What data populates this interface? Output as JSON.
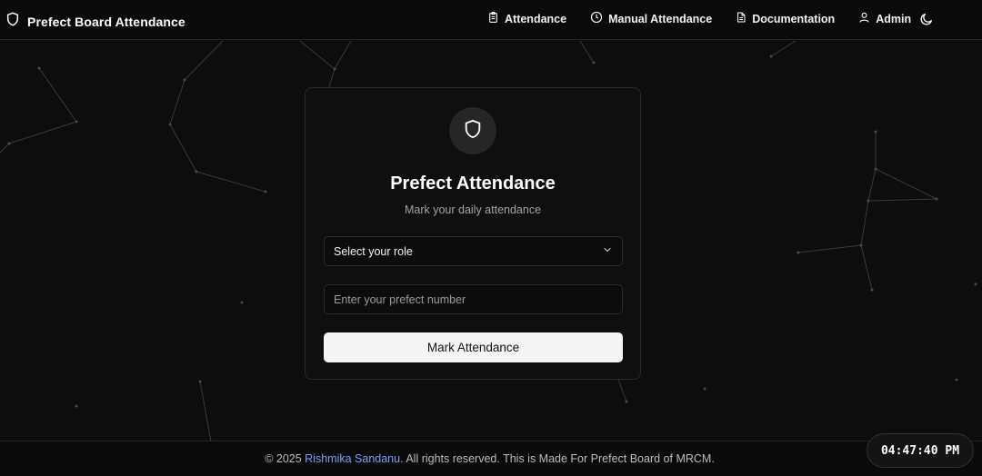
{
  "brand": {
    "title": "Prefect Board Attendance",
    "icon": "shield-icon"
  },
  "nav": {
    "items": [
      {
        "label": "Attendance",
        "icon": "clipboard-icon"
      },
      {
        "label": "Manual Attendance",
        "icon": "clock-icon"
      },
      {
        "label": "Documentation",
        "icon": "document-icon"
      },
      {
        "label": "Admin",
        "icon": "user-icon"
      }
    ],
    "theme_icon": "moon-icon"
  },
  "card": {
    "icon": "shield-icon",
    "title": "Prefect Attendance",
    "subtitle": "Mark your daily attendance",
    "role_select": {
      "value": "Select your role",
      "icon": "chevron-down-icon"
    },
    "prefect_number": {
      "placeholder": "Enter your prefect number",
      "value": ""
    },
    "submit_label": "Mark Attendance"
  },
  "footer": {
    "prefix": "© 2025 ",
    "author": "Rishmika Sandanu",
    "suffix": ". All rights reserved. This is Made For Prefect Board of MRCM."
  },
  "clock": {
    "time": "04:47:40 PM"
  },
  "colors": {
    "background": "#0d0d0d",
    "link": "#7aa2f7",
    "button": "#f5f5f5"
  }
}
